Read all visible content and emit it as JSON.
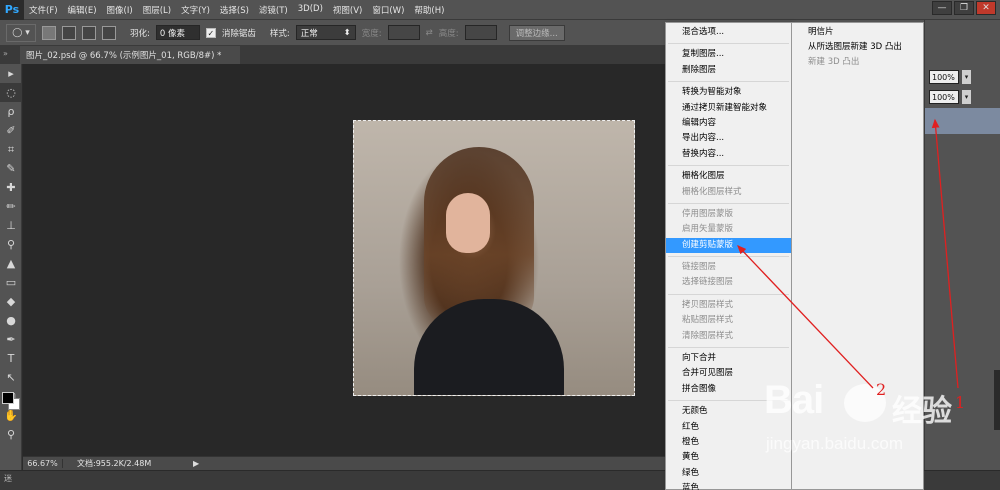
{
  "app": {
    "logo": "Ps"
  },
  "menubar": {
    "items": [
      "文件(F)",
      "编辑(E)",
      "图像(I)",
      "图层(L)",
      "文字(Y)",
      "选择(S)",
      "滤镜(T)",
      "3D(D)",
      "视图(V)",
      "窗口(W)",
      "帮助(H)"
    ]
  },
  "window_controls": {
    "minimize": "—",
    "restore": "❐",
    "close": "✕"
  },
  "options": {
    "tool_preset": "◯ ▾",
    "feather_label": "羽化:",
    "feather_value": "0 像素",
    "antialias_label": "消除锯齿",
    "antialias_checked": "✓",
    "style_label": "样式:",
    "style_value": "正常",
    "width_label": "宽度:",
    "height_label": "高度:",
    "swap": "⇄",
    "refine_edge": "调整边缘..."
  },
  "document": {
    "tab_title": "图片_02.psd @ 66.7% (示例图片_01, RGB/8#) *",
    "zoom": "66.67%",
    "doc_info": "文档:955.2K/2.48M",
    "status_arrow": "▶"
  },
  "tools": [
    "▸",
    "◌",
    "ρ",
    "✐",
    "⌗",
    "✎",
    "✚",
    "✏",
    "⊥",
    "⚲",
    "▲",
    "▭",
    "◆",
    "●",
    "✒",
    "T",
    "↖",
    "▢",
    "✋",
    "⚲"
  ],
  "context_menu": {
    "groups": [
      [
        {
          "label": "混合选项...",
          "disabled": false
        }
      ],
      [
        {
          "label": "复制图层...",
          "disabled": false
        },
        {
          "label": "删除图层",
          "disabled": false
        }
      ],
      [
        {
          "label": "转换为智能对象",
          "disabled": false
        },
        {
          "label": "通过拷贝新建智能对象",
          "disabled": false
        },
        {
          "label": "编辑内容",
          "disabled": false
        },
        {
          "label": "导出内容...",
          "disabled": false
        },
        {
          "label": "替换内容...",
          "disabled": false
        }
      ],
      [
        {
          "label": "栅格化图层",
          "disabled": false
        },
        {
          "label": "栅格化图层样式",
          "disabled": true
        }
      ],
      [
        {
          "label": "停用图层蒙版",
          "disabled": true
        },
        {
          "label": "启用矢量蒙版",
          "disabled": true
        },
        {
          "label": "创建剪贴蒙版",
          "disabled": false,
          "highlight": true
        }
      ],
      [
        {
          "label": "链接图层",
          "disabled": true
        },
        {
          "label": "选择链接图层",
          "disabled": true
        }
      ],
      [
        {
          "label": "拷贝图层样式",
          "disabled": true
        },
        {
          "label": "粘贴图层样式",
          "disabled": true
        },
        {
          "label": "清除图层样式",
          "disabled": true
        }
      ],
      [
        {
          "label": "向下合并",
          "disabled": false
        },
        {
          "label": "合并可见图层",
          "disabled": false
        },
        {
          "label": "拼合图像",
          "disabled": false
        }
      ],
      [
        {
          "label": "无颜色",
          "disabled": false
        },
        {
          "label": "红色",
          "disabled": false
        },
        {
          "label": "橙色",
          "disabled": false
        },
        {
          "label": "黄色",
          "disabled": false
        },
        {
          "label": "绿色",
          "disabled": false
        },
        {
          "label": "蓝色",
          "disabled": false
        }
      ]
    ]
  },
  "sub_menu": [
    {
      "label": "明信片",
      "disabled": false
    },
    {
      "label": "从所选图层新建 3D 凸出",
      "disabled": false
    },
    {
      "label": "新建 3D 凸出",
      "disabled": true
    }
  ],
  "right_panel": {
    "opacity": "100%",
    "fill": "100%",
    "arrow": "▾"
  },
  "annotations": {
    "one": "1",
    "two": "2"
  },
  "watermark": {
    "logo": "Bai",
    "cn": "经验",
    "url": "jingyan.baidu.com"
  },
  "bottom": {
    "mini_bridge": "迷"
  }
}
